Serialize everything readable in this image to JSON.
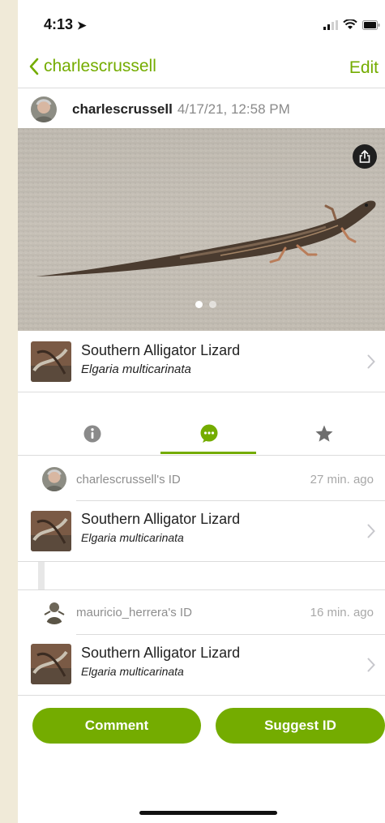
{
  "status_bar": {
    "time": "4:13"
  },
  "nav": {
    "back_label": "charlescrussell",
    "edit_label": "Edit"
  },
  "observation": {
    "username": "charlescrussell",
    "date": "4/17/21, 12:58 PM"
  },
  "photo": {
    "count": 2,
    "active_index": 0
  },
  "taxon": {
    "common_name": "Southern Alligator Lizard",
    "scientific_name": "Elgaria multicarinata"
  },
  "tabs": [
    "info-icon",
    "comment-icon",
    "star-icon"
  ],
  "identifications": [
    {
      "user_label": "charlescrussell's ID",
      "time": "27 min. ago",
      "common_name": "Southern Alligator Lizard",
      "scientific_name": "Elgaria multicarinata"
    },
    {
      "user_label": "mauricio_herrera's ID",
      "time": "16 min. ago",
      "common_name": "Southern Alligator Lizard",
      "scientific_name": "Elgaria multicarinata"
    }
  ],
  "actions": {
    "comment_label": "Comment",
    "suggest_label": "Suggest ID"
  },
  "colors": {
    "accent": "#74ac00",
    "divider": "#dcdcdc",
    "muted_text": "#8e8e8e"
  }
}
